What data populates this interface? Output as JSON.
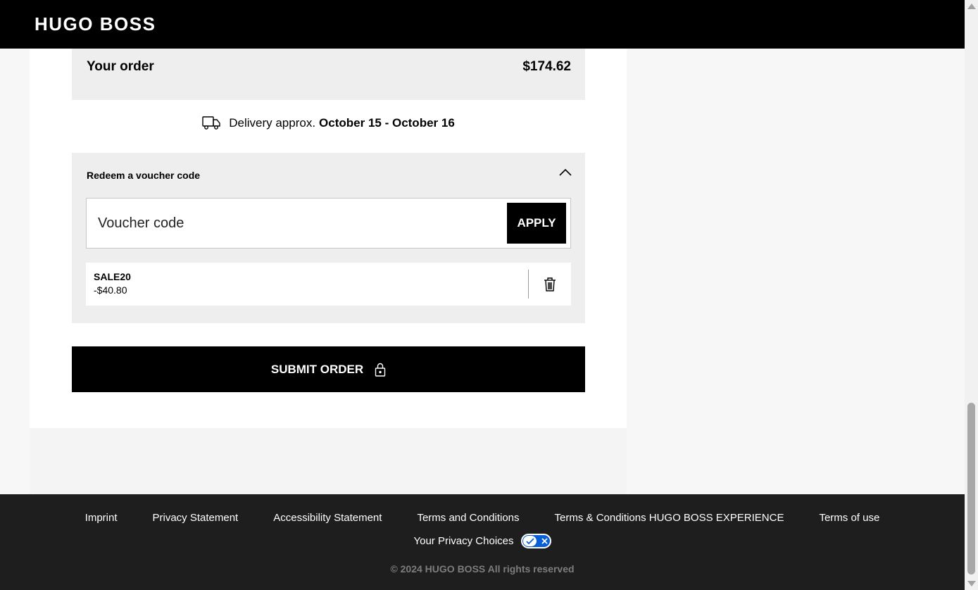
{
  "header": {
    "logo": "HUGO BOSS"
  },
  "order": {
    "title": "Your order",
    "total": "$174.62"
  },
  "delivery": {
    "prefix": "Delivery approx.",
    "dates": "October 15 - October 16"
  },
  "voucher": {
    "title": "Redeem a voucher code",
    "placeholder": "Voucher code",
    "value": "",
    "apply_label": "APPLY",
    "applied_code": "SALE20",
    "applied_amount": "-$40.80"
  },
  "submit": {
    "label": "SUBMIT ORDER"
  },
  "footer": {
    "links": [
      "Imprint",
      "Privacy Statement",
      "Accessibility Statement",
      "Terms and Conditions",
      "Terms & Conditions HUGO BOSS EXPERIENCE",
      "Terms of use"
    ],
    "privacy_choices": "Your Privacy Choices",
    "copyright": "© 2024 HUGO BOSS All rights reserved"
  },
  "colors": {
    "header_bg": "#000000",
    "panel_bg": "#eeeeee",
    "footer_bg": "#1e1e1e",
    "privacy_toggle": "#0b5fd6"
  },
  "icons": [
    "truck-icon",
    "chevron-up-icon",
    "trash-icon",
    "lock-icon",
    "privacy-toggle-icon"
  ]
}
